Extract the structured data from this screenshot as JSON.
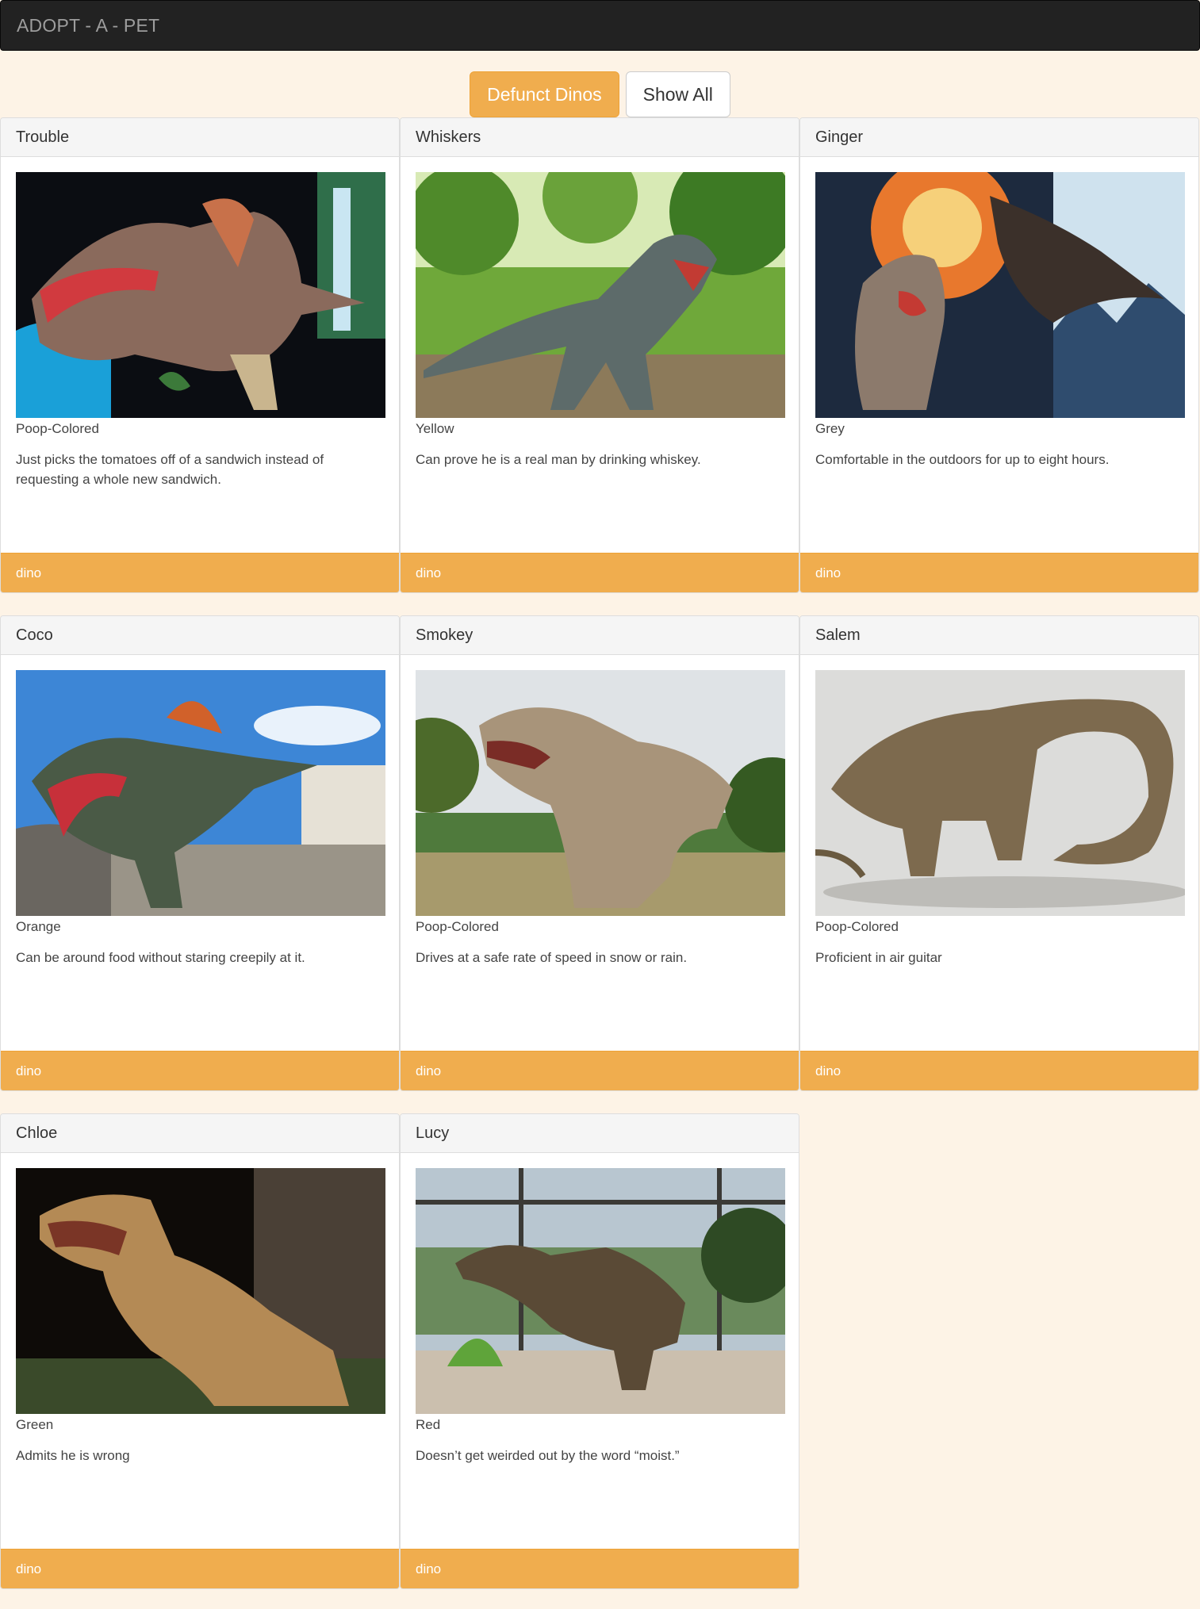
{
  "navbar": {
    "brand": "ADOPT - A - PET"
  },
  "filters": {
    "active_label": "Defunct Dinos",
    "all_label": "Show All"
  },
  "pets": [
    {
      "name": "Trouble",
      "color": "Poop-Colored",
      "description": "Just picks the tomatoes off of a sandwich instead of requesting a whole new sandwich.",
      "tag": "dino"
    },
    {
      "name": "Whiskers",
      "color": "Yellow",
      "description": "Can prove he is a real man by drinking whiskey.",
      "tag": "dino"
    },
    {
      "name": "Ginger",
      "color": "Grey",
      "description": "Comfortable in the outdoors for up to eight hours.",
      "tag": "dino"
    },
    {
      "name": "Coco",
      "color": "Orange",
      "description": "Can be around food without staring creepily at it.",
      "tag": "dino"
    },
    {
      "name": "Smokey",
      "color": "Poop-Colored",
      "description": "Drives at a safe rate of speed in snow or rain.",
      "tag": "dino"
    },
    {
      "name": "Salem",
      "color": "Poop-Colored",
      "description": "Proficient in air guitar",
      "tag": "dino"
    },
    {
      "name": "Chloe",
      "color": "Green",
      "description": "Admits he is wrong",
      "tag": "dino"
    },
    {
      "name": "Lucy",
      "color": "Red",
      "description": "Doesn’t get weirded out by the word “moist.”",
      "tag": "dino"
    }
  ],
  "colors": {
    "accent": "#f0ad4e",
    "navbar": "#222222",
    "page_bg": "#fdf3e6"
  }
}
